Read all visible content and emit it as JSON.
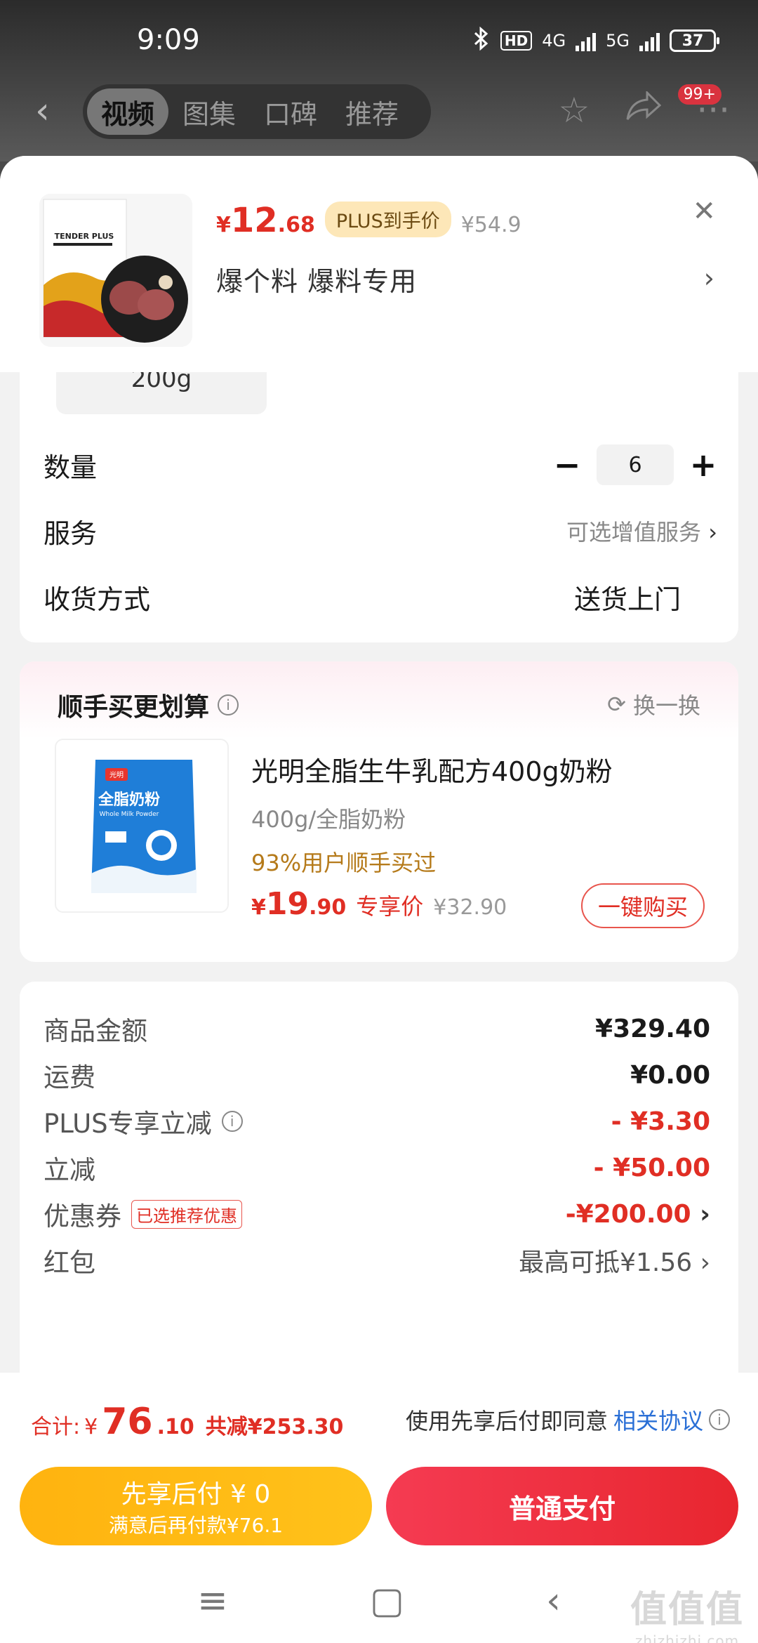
{
  "status": {
    "time": "9:09",
    "hd": "HD",
    "net1": "4G",
    "net2": "5G",
    "battery": "37"
  },
  "nav": {
    "tabs": [
      "视频",
      "图集",
      "口碑",
      "推荐"
    ],
    "badge": "99+"
  },
  "product": {
    "price_symbol": "¥",
    "price_int": "12",
    "price_dec": ".68",
    "plus_tag": "PLUS到手价",
    "original_price": "¥54.9",
    "selection": "爆个料  爆料专用",
    "thumb_brand": "TENDER PLUS"
  },
  "options": {
    "spec_chip": "200g",
    "quantity_label": "数量",
    "quantity": "6",
    "service_label": "服务",
    "service_value": "可选增值服务",
    "delivery_label": "收货方式",
    "delivery_value": "送货上门"
  },
  "addon": {
    "title": "顺手买更划算",
    "swap": "换一换",
    "name": "光明全脂生牛乳配方400g奶粉",
    "spec": "400g/全脂奶粉",
    "bought": "93%用户顺手买过",
    "price_symbol": "¥",
    "price_int": "19",
    "price_dec": ".90",
    "exclusive": "专享价",
    "original_price": "¥32.90",
    "buy_button": "一键购买",
    "thumb_brand": "光明",
    "thumb_text": "全脂奶粉",
    "thumb_sub": "Whole Milk Powder"
  },
  "fees": {
    "goods_label": "商品金额",
    "goods_value": "¥329.40",
    "shipping_label": "运费",
    "shipping_value": "¥0.00",
    "plus_label": "PLUS专享立减",
    "plus_value": "- ¥3.30",
    "discount_label": "立减",
    "discount_value": "- ¥50.00",
    "coupon_label": "优惠券",
    "coupon_tag": "已选推荐优惠",
    "coupon_value": "-¥200.00",
    "redpacket_label": "红包",
    "redpacket_value": "最高可抵¥1.56"
  },
  "bottom": {
    "total_label": "合计:",
    "total_symbol": "¥",
    "total_int": "76",
    "total_dec": ".10",
    "saved": "共减¥253.30",
    "agree_text": "使用先享后付即同意",
    "agree_link": "相关协议",
    "later_line1": "先享后付 ¥ 0",
    "later_line2": "满意后再付款¥76.1",
    "pay_button": "普通支付"
  },
  "watermark": {
    "text": "值值值",
    "sub": "zhizhizhi.com"
  },
  "colors": {
    "accent_red": "#e02e24",
    "plus_gold": "#fde7b8",
    "later_yellow": "#ffb30f",
    "link_blue": "#2a6fd6"
  }
}
